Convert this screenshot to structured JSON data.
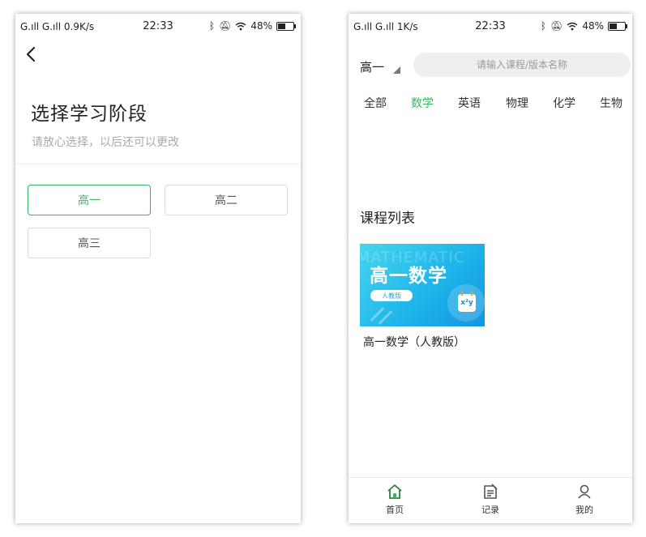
{
  "left_screen": {
    "status": {
      "network": "G.ıll G.ıll 0.9K/s",
      "time": "22:33",
      "battery": "48%"
    },
    "title": "选择学习阶段",
    "subtitle": "请放心选择，以后还可以更改",
    "grades": [
      {
        "label": "高一",
        "selected": true
      },
      {
        "label": "高二",
        "selected": false
      },
      {
        "label": "高三",
        "selected": false
      }
    ]
  },
  "right_screen": {
    "status": {
      "network": "G.ıll G.ıll 1K/s",
      "time": "22:33",
      "battery": "48%"
    },
    "grade": "高一",
    "search_placeholder": "请输入课程/版本名称",
    "tabs": [
      {
        "label": "全部",
        "active": false
      },
      {
        "label": "数学",
        "active": true
      },
      {
        "label": "英语",
        "active": false
      },
      {
        "label": "物理",
        "active": false
      },
      {
        "label": "化学",
        "active": false
      },
      {
        "label": "生物",
        "active": false
      }
    ],
    "section_title": "课程列表",
    "course": {
      "cover_bg_text": "MATHEMATIC",
      "cover_title": "高一数学",
      "cover_badge": "人教版",
      "cover_icon_text": "x²y",
      "name": "高一数学（人教版）"
    },
    "bottom_nav": [
      {
        "label": "首页",
        "icon": "home-icon",
        "active": true
      },
      {
        "label": "记录",
        "icon": "notes-icon",
        "active": false
      },
      {
        "label": "我的",
        "icon": "profile-icon",
        "active": false
      }
    ]
  },
  "colors": {
    "accent": "#3cb563",
    "subtitle": "#a9a9a9",
    "search_bg": "#efefef"
  }
}
